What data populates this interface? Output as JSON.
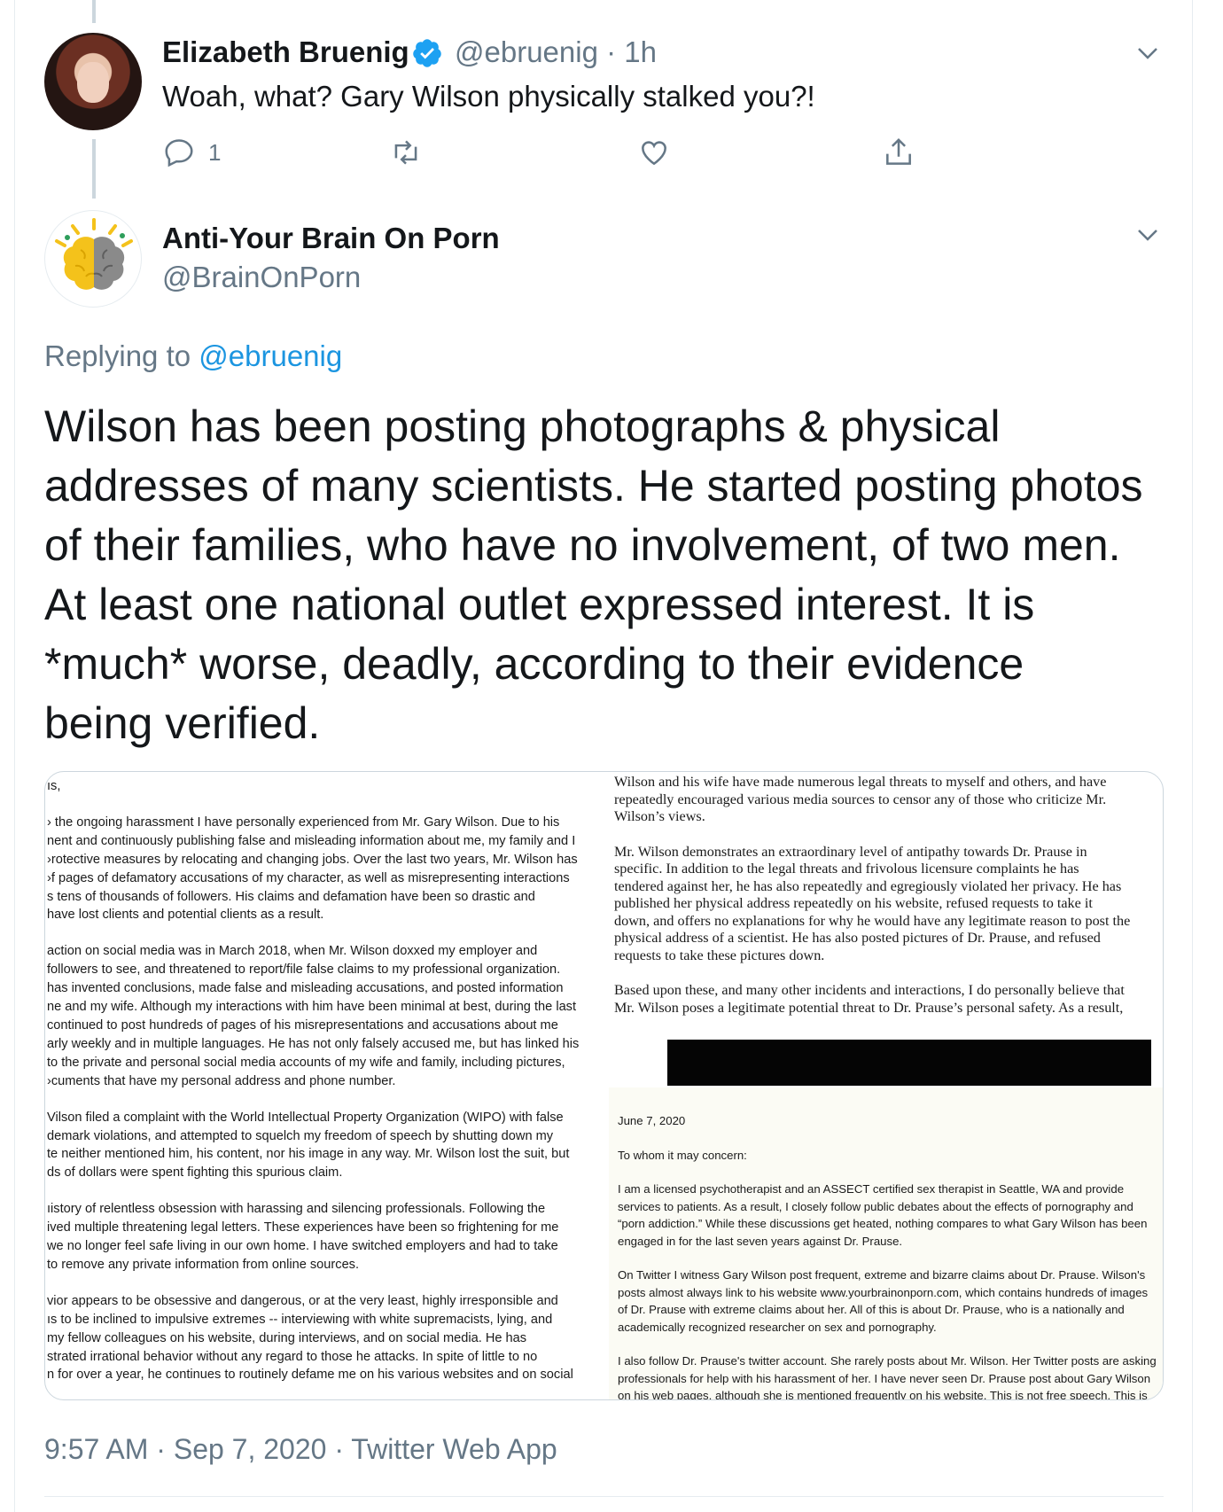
{
  "reply_tweet": {
    "name": "Elizabeth Bruenig",
    "handle_time": "@ebruenig · 1h",
    "text": "Woah, what? Gary Wilson physically stalked you?!",
    "reply_count": "1"
  },
  "main_tweet": {
    "name": "Anti-Your Brain On Porn",
    "handle": "@BrainOnPorn",
    "replying_prefix": "Replying to ",
    "replying_mention": "@ebruenig",
    "body": "Wilson has been posting photographs & physical\naddresses of many scientists. He started posting photos\nof their families, who have no involvement, of two men.\nAt least one national outlet expressed interest. It is\n*much* worse, deadly, according to their evidence\nbeing verified.",
    "timestamp": "9:57 AM · Sep 7, 2020 · Twitter Web App"
  },
  "media": {
    "left_doc": {
      "salutation": "ıs,",
      "p1": "› the ongoing harassment I have personally experienced from Mr. Gary Wilson. Due to his\nnent and continuously publishing false and misleading information about me, my family and I\n›rotective measures by relocating and changing jobs. Over the last two years, Mr. Wilson has\n›f pages of defamatory accusations of my character, as well as misrepresenting interactions\ns tens of thousands of followers. His claims and defamation have been so drastic and\nhave lost clients and potential clients as a result.",
      "p2": "action on social media was in March 2018, when Mr. Wilson doxxed my employer and\nfollowers to see, and threatened to report/file false claims to my professional organization.\nhas invented conclusions, made false and misleading accusations, and posted information\nne and my wife. Although my interactions with him have been minimal at best, during the last\ncontinued to post hundreds of pages of his misrepresentations and accusations about me\narly weekly and in multiple languages. He has not only falsely accused me, but has linked his\nto the private and personal social media accounts of my wife and family, including pictures,\n›cuments that have my personal address and phone number.",
      "p3": "Vilson filed a complaint with the World Intellectual Property Organization (WIPO) with false\ndemark violations, and attempted to squelch my freedom of speech by shutting down my\nte neither mentioned him, his content, nor his image in any way. Mr. Wilson lost the suit, but\nds of dollars were spent fighting this spurious claim.",
      "p4": "ıistory of relentless obsession with harassing and silencing professionals.  Following the\nived multiple threatening legal letters. These experiences have been so frightening for me\nwe no longer feel safe living in our own home. I have switched employers and had to take\nto remove any private information from online sources.",
      "p5": "vior appears to be obsessive and dangerous, or at the very least, highly irresponsible and\nıs to be inclined to impulsive extremes -- interviewing with white supremacists, lying, and\nmy fellow colleagues on his website, during interviews, and on social media. He has\nstrated irrational behavior without any regard to those he attacks. In spite of little to no\nn for over a year, he continues to routinely defame me on his various websites and on social"
    },
    "right_doc": {
      "p1": "Wilson and his wife have made numerous legal threats to myself and others, and have\nrepeatedly encouraged various media sources to censor any of those who criticize Mr.\nWilson’s views.",
      "p2": "Mr. Wilson demonstrates an extraordinary level of antipathy towards Dr. Prause in\nspecific. In addition to the legal threats and frivolous licensure complaints he has\ntendered against her, he has also repeatedly and egregiously violated her privacy. He has\npublished her physical address repeatedly on his website, refused requests to take it\ndown, and offers no explanations for why he would have any legitimate reason to post the\nphysical address of a scientist. He has also posted pictures of Dr. Prause, and refused\nrequests to take these pictures down.",
      "p3": "Based upon these, and many other incidents and interactions, I do personally believe that\nMr. Wilson poses a legitimate potential threat to Dr. Prause’s personal safety. As a result,"
    },
    "letter": {
      "date": "June 7, 2020",
      "greeting": "To whom it may concern:",
      "p1": "I am a licensed psychotherapist and an ASSECT certified sex therapist in Seattle, WA and provide\nservices to patients. As a result, I closely follow public debates about the effects of pornography and\n“porn addiction.” While these discussions get heated, nothing compares to what Gary Wilson has been\nengaged in for the last seven years against Dr. Prause.",
      "p2": "On Twitter I witness Gary Wilson post frequent, extreme and bizarre claims about Dr. Prause. Wilson's\nposts almost always link to his website www.yourbrainonporn.com, which contains hundreds of images\nof Dr. Prause with extreme claims about her. All of this is about Dr. Prause, who is a nationally and\nacademically recognized researcher on sex and pornography.",
      "p3": "I also follow Dr. Prause's twitter account. She rarely posts about Mr. Wilson. Her Twitter posts are asking\nprofessionals for help with his harassment of her. I have never seen Dr. Prause post about Gary Wilson\non his web pages, although she is mentioned frequently on his website. This is not free speech. This is\nharassment."
    }
  },
  "icons": {
    "verified": "verified-badge-icon",
    "reply": "reply-icon",
    "retweet": "retweet-icon",
    "like": "heart-icon",
    "share": "share-icon",
    "more": "chevron-down-icon"
  },
  "colors": {
    "accent": "#1da1f2",
    "muted": "#657786",
    "text": "#14171a"
  }
}
